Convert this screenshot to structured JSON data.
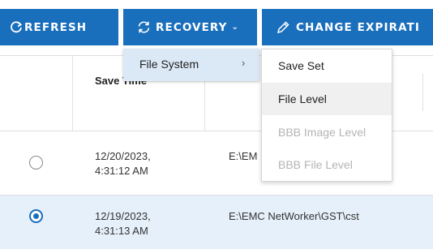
{
  "toolbar": {
    "refresh_label": "REFRESH",
    "recovery_label": "RECOVERY",
    "change_expiration_label": "CHANGE EXPIRATI"
  },
  "table": {
    "headers": [
      "Save Time",
      ""
    ],
    "rows": [
      {
        "selected": false,
        "date": "12/20/2023,",
        "time": "4:31:12 AM",
        "path": "E:\\EM"
      },
      {
        "selected": true,
        "date": "12/19/2023,",
        "time": "4:31:13 AM",
        "path": "E:\\EMC NetWorker\\GST\\cst"
      }
    ]
  },
  "recovery_menu": {
    "items": [
      {
        "label": "File System",
        "has_submenu": true
      }
    ]
  },
  "file_system_submenu": {
    "items": [
      {
        "label": "Save Set",
        "disabled": false
      },
      {
        "label": "File Level",
        "disabled": false
      },
      {
        "label": "BBB Image Level",
        "disabled": true
      },
      {
        "label": "BBB File Level",
        "disabled": true
      }
    ]
  },
  "colors": {
    "accent": "#1a6fbd",
    "selected_row": "#e6f0fa",
    "menu_highlight": "#dbe8f5"
  }
}
